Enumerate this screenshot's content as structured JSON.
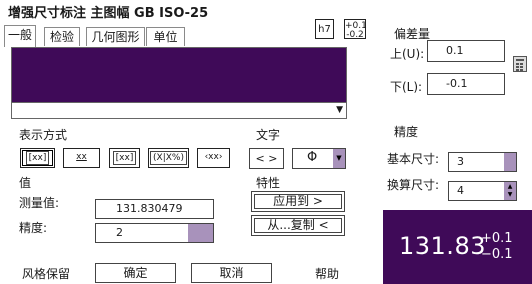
{
  "title": "增强尺寸标注 主图幅 GB ISO-25",
  "tol_buttons": {
    "fit": "h7",
    "deviation_top": "+0.1",
    "deviation_bottom": "-0.2"
  },
  "tabs": [
    "一般",
    "检验",
    "几何图形",
    "单位"
  ],
  "display": {
    "heading": "表示方式",
    "style_buttons": [
      "[xx]",
      "xx",
      "[xx]",
      "(X|X%)",
      "‹xx›"
    ]
  },
  "text": {
    "heading": "文字",
    "bracket_label": "< >",
    "symbol_selected": "Φ"
  },
  "value": {
    "heading": "值",
    "measured_label": "测量值:",
    "measured_value": "131.830479",
    "precision_label": "精度:",
    "precision_value": "2"
  },
  "properties": {
    "heading": "特性",
    "apply_button": "应用到 >",
    "copy_button": "从...复制 <"
  },
  "deviation": {
    "heading": "偏差量",
    "upper_label": "上(U):",
    "upper_value": "0.1",
    "lower_label": "下(L):",
    "lower_value": "-0.1"
  },
  "precision": {
    "heading": "精度",
    "basic_label": "基本尺寸:",
    "basic_value": "3",
    "alt_label": "换算尺寸:",
    "alt_value": "4"
  },
  "preview": {
    "value": "131.83",
    "tol_upper": "+0.1",
    "tol_lower": "−0.1"
  },
  "footer": {
    "style_keep": "风格保留",
    "ok": "确定",
    "cancel": "取消",
    "help": "帮助"
  },
  "colors": {
    "accent": "#3f0a58",
    "spin": "#a892bb"
  }
}
